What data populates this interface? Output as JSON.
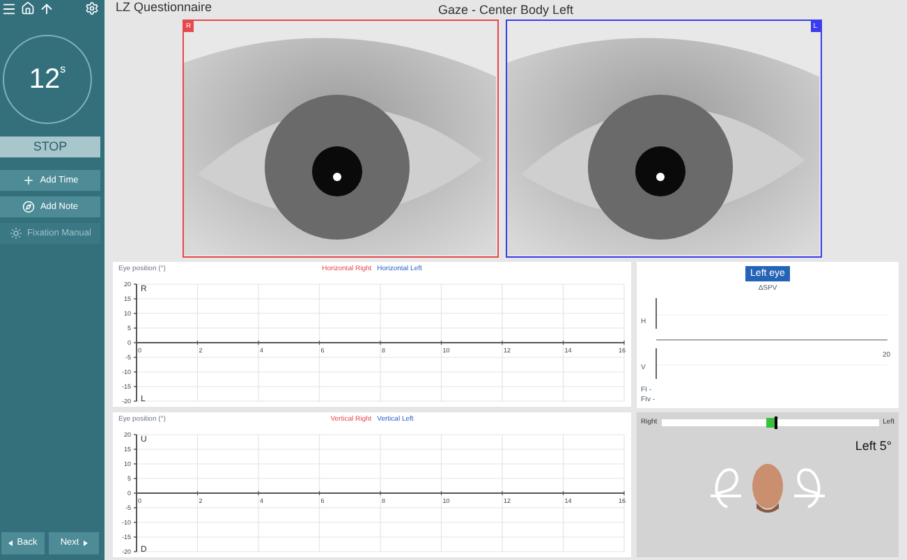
{
  "sidebar": {
    "timer": {
      "value": "12",
      "unit": "s"
    },
    "stop_button": "STOP",
    "actions": [
      {
        "label": "Add Time",
        "disabled": false
      },
      {
        "label": "Add Note",
        "disabled": false
      },
      {
        "label": "Fixation Manual",
        "disabled": true
      }
    ],
    "nav": {
      "back": "Back",
      "next": "Next"
    }
  },
  "header": {
    "title": "LZ Questionnaire",
    "subtitle": "Gaze - Center Body Left"
  },
  "eyes": [
    {
      "badge": "R",
      "color": "#e8474c"
    },
    {
      "badge": "L",
      "color": "#3b3bf0"
    }
  ],
  "charts": [
    {
      "top_label": "R",
      "bottom_label": "L",
      "chart_data": {
        "type": "line",
        "ylabel": "Eye position (°)",
        "categories": [
          "0",
          "2",
          "4",
          "6",
          "8",
          "10",
          "12",
          "14",
          "16"
        ],
        "ylim": [
          -20,
          20
        ],
        "yticks": [
          -20,
          -15,
          -10,
          -5,
          0,
          5,
          10,
          15,
          20
        ],
        "grid": true,
        "series": [
          {
            "name": "Horizontal Right",
            "color": "#e8474c",
            "values": [
              null,
              null,
              null,
              null,
              null,
              null,
              null,
              null,
              null
            ]
          },
          {
            "name": "Horizontal Left",
            "color": "#2a62c9",
            "values": [
              null,
              null,
              null,
              null,
              null,
              null,
              null,
              null,
              null
            ]
          }
        ]
      }
    },
    {
      "top_label": "U",
      "bottom_label": "D",
      "chart_data": {
        "type": "line",
        "ylabel": "Eye position (°)",
        "categories": [
          "0",
          "2",
          "4",
          "6",
          "8",
          "10",
          "12",
          "14",
          "16"
        ],
        "ylim": [
          -20,
          20
        ],
        "yticks": [
          -20,
          -15,
          -10,
          -5,
          0,
          5,
          10,
          15,
          20
        ],
        "grid": true,
        "series": [
          {
            "name": "Vertical Right",
            "color": "#e8474c",
            "values": [
              null,
              null,
              null,
              null,
              null,
              null,
              null,
              null,
              null
            ]
          },
          {
            "name": "Vertical Left",
            "color": "#2a62c9",
            "values": [
              null,
              null,
              null,
              null,
              null,
              null,
              null,
              null,
              null
            ]
          }
        ]
      }
    }
  ],
  "spv_panel": {
    "eye_button": "Left eye",
    "title": "ΔSPV",
    "h_label": "H",
    "v_label": "V",
    "x_end": "20",
    "fi": "FI -",
    "fiv": "FIv -"
  },
  "head_position": {
    "left_label": "Right",
    "right_label": "Left",
    "level": 0.52,
    "reading": "Left 5°"
  }
}
